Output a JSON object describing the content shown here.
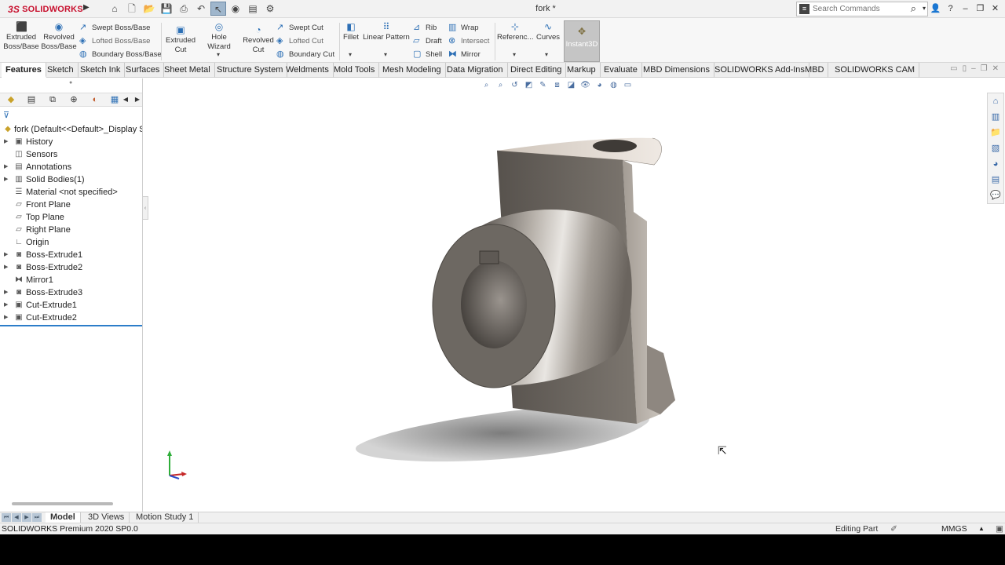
{
  "app": {
    "brand": "SOLIDWORKS",
    "brand_prefix": "3S",
    "document_title": "fork *",
    "search_placeholder": "Search Commands"
  },
  "quick_access": [
    "home-icon",
    "new-icon",
    "open-icon",
    "save-icon",
    "print-icon",
    "undo-icon",
    "select-icon",
    "rebuild-icon",
    "file-properties-icon",
    "options-icon"
  ],
  "command_manager": {
    "extruded_boss": "Extruded Boss/Base",
    "revolved_boss": "Revolved Boss/Base",
    "swept_boss": "Swept Boss/Base",
    "lofted_boss": "Lofted Boss/Base",
    "boundary_boss": "Boundary Boss/Base",
    "extruded_cut": "Extruded Cut",
    "hole_wizard": "Hole Wizard",
    "revolved_cut": "Revolved Cut",
    "swept_cut": "Swept Cut",
    "lofted_cut": "Lofted Cut",
    "boundary_cut": "Boundary Cut",
    "fillet": "Fillet",
    "linear_pattern": "Linear Pattern",
    "rib": "Rib",
    "draft": "Draft",
    "shell": "Shell",
    "wrap": "Wrap",
    "intersect": "Intersect",
    "mirror": "Mirror",
    "reference": "Referenc...",
    "curves": "Curves",
    "instant3d": "Instant3D"
  },
  "tabs": [
    "Features",
    "Sketch",
    "Sketch Ink",
    "Surfaces",
    "Sheet Metal",
    "Structure System",
    "Weldments",
    "Mold Tools",
    "Mesh Modeling",
    "Data Migration",
    "Direct Editing",
    "Markup",
    "Evaluate",
    "MBD Dimensions",
    "SOLIDWORKS Add-Ins",
    "MBD",
    "SOLIDWORKS CAM"
  ],
  "active_tab": "Features",
  "feature_tree": {
    "root": "fork  (Default<<Default>_Display Sta",
    "items": [
      {
        "label": "History",
        "icon": "history-folder-icon",
        "expandable": true
      },
      {
        "label": "Sensors",
        "icon": "sensors-icon",
        "expandable": false
      },
      {
        "label": "Annotations",
        "icon": "annotations-icon",
        "expandable": true
      },
      {
        "label": "Solid Bodies(1)",
        "icon": "solid-bodies-icon",
        "expandable": true
      },
      {
        "label": "Material <not specified>",
        "icon": "material-icon",
        "expandable": false
      },
      {
        "label": "Front Plane",
        "icon": "plane-icon",
        "expandable": false
      },
      {
        "label": "Top Plane",
        "icon": "plane-icon",
        "expandable": false
      },
      {
        "label": "Right Plane",
        "icon": "plane-icon",
        "expandable": false
      },
      {
        "label": "Origin",
        "icon": "origin-icon",
        "expandable": false
      },
      {
        "label": "Boss-Extrude1",
        "icon": "boss-extrude-icon",
        "expandable": true
      },
      {
        "label": "Boss-Extrude2",
        "icon": "boss-extrude-icon",
        "expandable": true
      },
      {
        "label": "Mirror1",
        "icon": "mirror-icon",
        "expandable": false
      },
      {
        "label": "Boss-Extrude3",
        "icon": "boss-extrude-icon",
        "expandable": true
      },
      {
        "label": "Cut-Extrude1",
        "icon": "cut-extrude-icon",
        "expandable": true
      },
      {
        "label": "Cut-Extrude2",
        "icon": "cut-extrude-icon",
        "expandable": true
      }
    ]
  },
  "bottom_tabs": [
    "Model",
    "3D Views",
    "Motion Study 1"
  ],
  "active_bottom_tab": "Model",
  "status": {
    "product": "SOLIDWORKS Premium 2020 SP0.0",
    "mode": "Editing Part",
    "units": "MMGS"
  },
  "colors": {
    "brand_red": "#c8102e",
    "accent_blue": "#2c7dc9",
    "part_gray": "#6f6a64"
  }
}
